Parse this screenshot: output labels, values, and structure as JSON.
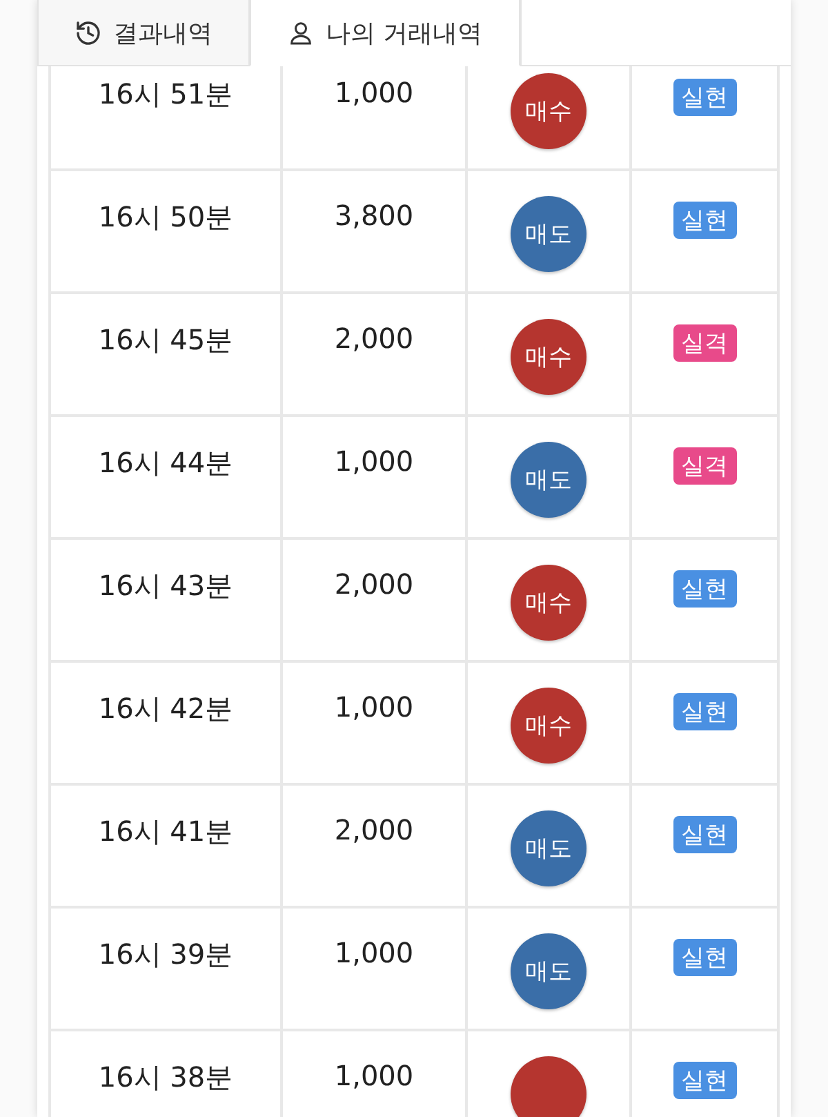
{
  "tabs": [
    {
      "label": "결과내역",
      "selected": false
    },
    {
      "label": "나의 거래내역",
      "selected": true
    }
  ],
  "rows": [
    {
      "time": "16시 51분",
      "amount": "1,000",
      "side": {
        "kind": "buy",
        "label": "매수"
      },
      "result": {
        "kind": "hit",
        "label": "실현"
      }
    },
    {
      "time": "16시 50분",
      "amount": "3,800",
      "side": {
        "kind": "sell",
        "label": "매도"
      },
      "result": {
        "kind": "hit",
        "label": "실현"
      }
    },
    {
      "time": "16시 45분",
      "amount": "2,000",
      "side": {
        "kind": "buy",
        "label": "매수"
      },
      "result": {
        "kind": "miss",
        "label": "실격"
      }
    },
    {
      "time": "16시 44분",
      "amount": "1,000",
      "side": {
        "kind": "sell",
        "label": "매도"
      },
      "result": {
        "kind": "miss",
        "label": "실격"
      }
    },
    {
      "time": "16시 43분",
      "amount": "2,000",
      "side": {
        "kind": "buy",
        "label": "매수"
      },
      "result": {
        "kind": "hit",
        "label": "실현"
      }
    },
    {
      "time": "16시 42분",
      "amount": "1,000",
      "side": {
        "kind": "buy",
        "label": "매수"
      },
      "result": {
        "kind": "hit",
        "label": "실현"
      }
    },
    {
      "time": "16시 41분",
      "amount": "2,000",
      "side": {
        "kind": "sell",
        "label": "매도"
      },
      "result": {
        "kind": "hit",
        "label": "실현"
      }
    },
    {
      "time": "16시 39분",
      "amount": "1,000",
      "side": {
        "kind": "sell",
        "label": "매도"
      },
      "result": {
        "kind": "hit",
        "label": "실현"
      }
    },
    {
      "time": "16시 38분",
      "amount": "1,000",
      "side": {
        "kind": "buy"
      },
      "result": {
        "kind": "hit",
        "label": "실현"
      }
    }
  ]
}
